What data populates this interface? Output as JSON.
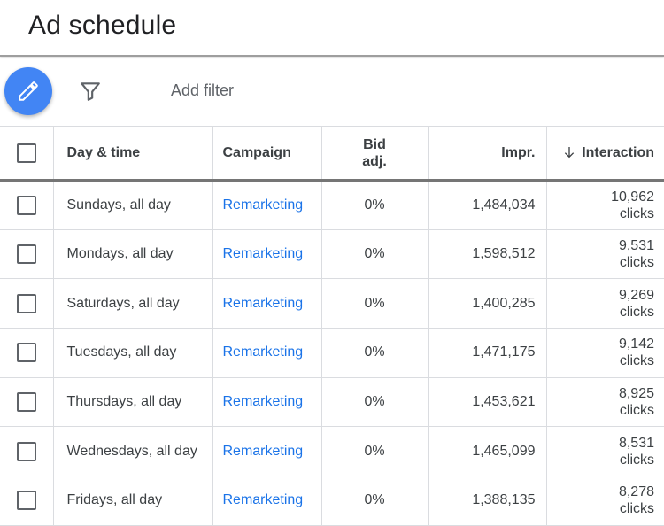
{
  "header": {
    "title": "Ad schedule"
  },
  "toolbar": {
    "add_filter_label": "Add filter"
  },
  "table": {
    "columns": {
      "day": "Day & time",
      "campaign": "Campaign",
      "bid_line1": "Bid",
      "bid_line2": "adj.",
      "impr": "Impr.",
      "interaction": "Interaction"
    },
    "rows": [
      {
        "day": "Sundays, all day",
        "campaign": "Remarketing",
        "bid": "0%",
        "impr": "1,484,034",
        "interactions": "10,962",
        "unit": "clicks"
      },
      {
        "day": "Mondays, all day",
        "campaign": "Remarketing",
        "bid": "0%",
        "impr": "1,598,512",
        "interactions": "9,531",
        "unit": "clicks"
      },
      {
        "day": "Saturdays, all day",
        "campaign": "Remarketing",
        "bid": "0%",
        "impr": "1,400,285",
        "interactions": "9,269",
        "unit": "clicks"
      },
      {
        "day": "Tuesdays, all day",
        "campaign": "Remarketing",
        "bid": "0%",
        "impr": "1,471,175",
        "interactions": "9,142",
        "unit": "clicks"
      },
      {
        "day": "Thursdays, all day",
        "campaign": "Remarketing",
        "bid": "0%",
        "impr": "1,453,621",
        "interactions": "8,925",
        "unit": "clicks"
      },
      {
        "day": "Wednesdays, all day",
        "campaign": "Remarketing",
        "bid": "0%",
        "impr": "1,465,099",
        "interactions": "8,531",
        "unit": "clicks"
      },
      {
        "day": "Fridays, all day",
        "campaign": "Remarketing",
        "bid": "0%",
        "impr": "1,388,135",
        "interactions": "8,278",
        "unit": "clicks"
      }
    ]
  },
  "colors": {
    "fab": "#4285f4",
    "link": "#1a73e8",
    "text": "#3c4043"
  },
  "icons": {
    "fab": "pencil-icon",
    "filter": "filter-icon",
    "sort": "arrow-down-icon"
  }
}
